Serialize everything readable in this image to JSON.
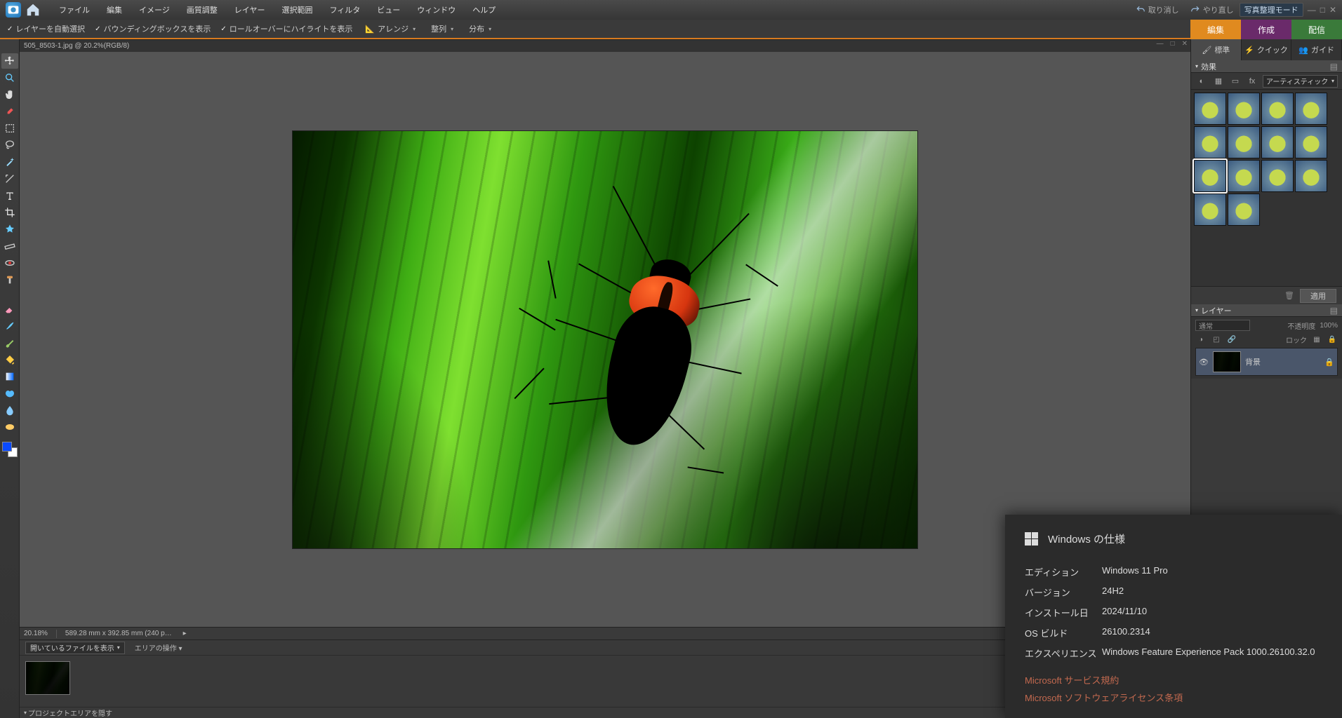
{
  "menubar": {
    "items": [
      "ファイル",
      "編集",
      "イメージ",
      "画質調整",
      "レイヤー",
      "選択範囲",
      "フィルタ",
      "ビュー",
      "ウィンドウ",
      "ヘルプ"
    ],
    "undo": "取り消し",
    "redo": "やり直し",
    "mode_button": "写真整理モード"
  },
  "mode_tabs": {
    "edit": "編集",
    "create": "作成",
    "share": "配信"
  },
  "optbar": {
    "chk1": "レイヤーを自動選択",
    "chk2": "バウンディングボックスを表示",
    "chk3": "ロールオーバーにハイライトを表示",
    "arrange": "アレンジ",
    "align": "整列",
    "distribute": "分布"
  },
  "doc": {
    "tab": "505_8503-1.jpg @ 20.2%(RGB/8)",
    "zoom": "20.18%",
    "dims": "589.28 mm x 392.85 mm (240 p…"
  },
  "view_tabs": {
    "standard": "標準",
    "quick": "クイック",
    "guided": "ガイド"
  },
  "effects": {
    "title": "効果",
    "category": "アーティスティック",
    "apply": "適用"
  },
  "layers": {
    "title": "レイヤー",
    "blend": "通常",
    "opacity_label": "不透明度",
    "opacity_value": "100%",
    "lock_label": "ロック",
    "layer0": "背景"
  },
  "bottom": {
    "open_files": "開いているファイルを表示",
    "area_ops": "エリアの操作",
    "hide_project": "プロジェクトエリアを隠す"
  },
  "windows": {
    "heading": "Windows の仕様",
    "rows": {
      "edition_k": "エディション",
      "edition_v": "Windows 11 Pro",
      "version_k": "バージョン",
      "version_v": "24H2",
      "install_k": "インストール日",
      "install_v": "2024/11/10",
      "build_k": "OS ビルド",
      "build_v": "26100.2314",
      "exp_k": "エクスペリエンス",
      "exp_v": "Windows Feature Experience Pack 1000.26100.32.0"
    },
    "link1": "Microsoft サービス規約",
    "link2": "Microsoft ソフトウェアライセンス条項"
  }
}
